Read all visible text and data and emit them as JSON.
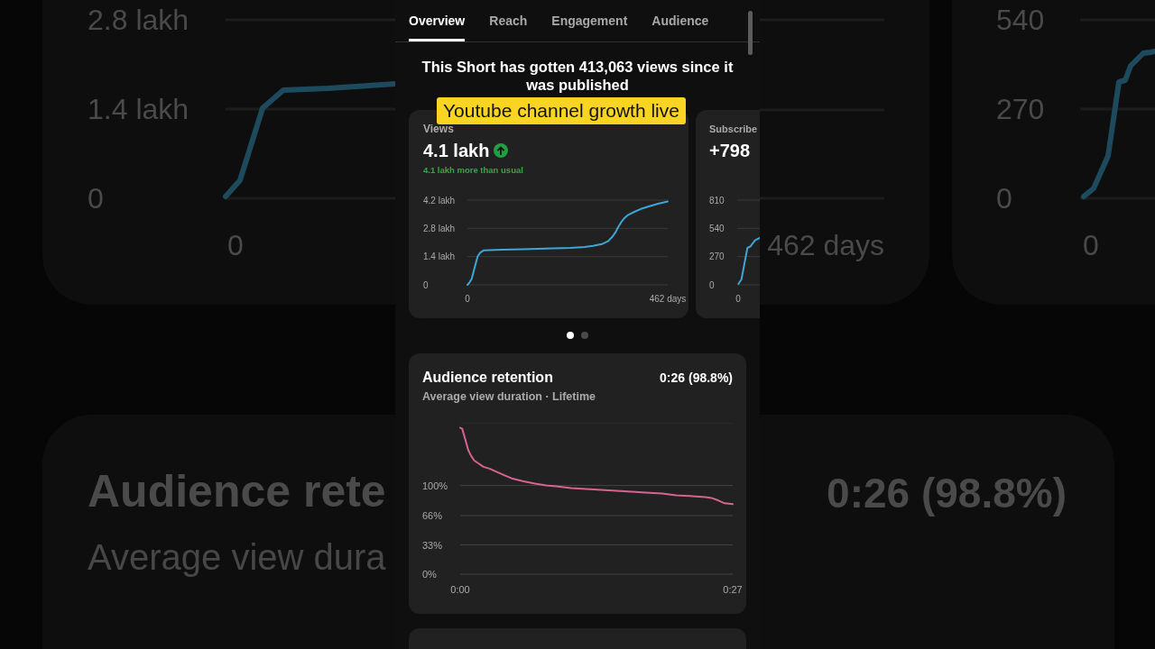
{
  "tabs": [
    {
      "label": "Overview",
      "selected": true
    },
    {
      "label": "Reach",
      "selected": false
    },
    {
      "label": "Engagement",
      "selected": false
    },
    {
      "label": "Audience",
      "selected": false
    }
  ],
  "headline": "This Short has gotten 413,063 views since it was published",
  "caption_overlay": {
    "text": "Youtube channel growth live"
  },
  "metric_cards": [
    {
      "kind": "chart",
      "title": "Views",
      "value": "4.1 lakh",
      "trend_up": true,
      "comparison": "4.1 lakh more than usual",
      "chart_data": {
        "type": "line",
        "x": [
          0,
          5,
          10,
          16,
          24,
          30,
          38,
          80,
          130,
          180,
          238,
          270,
          290,
          310,
          325,
          335,
          342,
          348,
          355,
          362,
          371,
          385,
          400,
          420,
          440,
          462
        ],
        "series": [
          {
            "color": "#3ea6d6",
            "values": [
              0,
              0.12,
              0.3,
              0.8,
              1.43,
              1.6,
              1.71,
              1.74,
              1.77,
              1.8,
              1.83,
              1.87,
              1.93,
              2.02,
              2.17,
              2.4,
              2.62,
              2.87,
              3.12,
              3.3,
              3.47,
              3.62,
              3.76,
              3.9,
              4.02,
              4.13
            ]
          }
        ],
        "xlim": [
          0,
          462
        ],
        "ylim": [
          0,
          4.2
        ],
        "xticks": [
          {
            "value": 0,
            "label": "0"
          },
          {
            "value": 462,
            "label": "462 days"
          }
        ],
        "yticks": [
          {
            "value": 0,
            "label": "0"
          },
          {
            "value": 1.4,
            "label": "1.4 lakh"
          },
          {
            "value": 2.8,
            "label": "2.8 lakh"
          },
          {
            "value": 4.2,
            "label": "4.2 lakh"
          }
        ],
        "grid": true
      }
    },
    {
      "kind": "sketch",
      "title": "Subscribe",
      "value": "+798",
      "axis_labels": [
        "810",
        "540",
        "270",
        "0"
      ],
      "x_label": "0"
    }
  ],
  "pager": [
    {
      "selected": true
    },
    {
      "selected": false
    }
  ],
  "retention": {
    "title": "Audience retention",
    "value": "0:26 (98.8%)",
    "subtitle": "Average view duration · Lifetime",
    "chart_data": {
      "type": "line",
      "x": [
        0,
        0.2,
        0.5,
        0.8,
        1.1,
        1.4,
        1.8,
        2.3,
        2.9,
        3.5,
        4.3,
        5.1,
        6.2,
        7.4,
        8.5,
        9.5,
        11,
        12.5,
        14,
        15.5,
        17,
        18.4,
        20,
        21.4,
        23,
        24.3,
        24.9,
        25.6,
        26.2,
        27
      ],
      "series": [
        {
          "color": "#d7638f",
          "values": [
            165,
            164,
            152,
            140,
            133,
            128,
            125,
            121,
            119,
            116,
            112,
            108,
            105,
            102,
            100,
            99,
            97,
            96,
            95,
            94,
            93,
            92,
            91,
            89,
            88,
            87,
            86,
            83,
            80,
            79
          ]
        }
      ],
      "xlim": [
        0,
        27
      ],
      "ylim": [
        0,
        170
      ],
      "xticks": [
        {
          "value": 0,
          "label": "0:00"
        },
        {
          "value": 27,
          "label": "0:27"
        }
      ],
      "yticks": [
        {
          "value": 0,
          "label": "0%"
        },
        {
          "value": 33,
          "label": "33%"
        },
        {
          "value": 66,
          "label": "66%"
        },
        {
          "value": 100,
          "label": "100%"
        }
      ],
      "grid": true
    }
  },
  "backdrop": {
    "left": {
      "views_card": {
        "axis_labels": [
          "2.8 lakh",
          "1.4 lakh",
          "0"
        ],
        "x_label": "0"
      },
      "retention_card": {
        "title": "Audience rete",
        "subtitle": "Average view dura"
      }
    },
    "right": {
      "views_card": {
        "x_label": "462 days"
      },
      "subscribers_card": {
        "axis_labels": [
          "540",
          "270",
          "0"
        ],
        "x_label": "0"
      },
      "retention_card": {
        "value": "0:26 (98.8%)"
      }
    }
  }
}
